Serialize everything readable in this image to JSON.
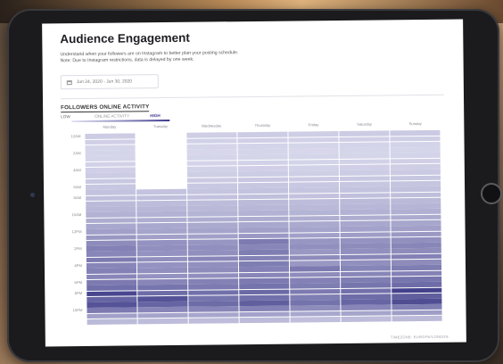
{
  "page": {
    "title": "Audience Engagement",
    "description_line1": "Understand when your followers are on Instagram to better plan your posting schedule.",
    "description_line2": "Note: Due to Instagram restrictions, data is delayed by one week.",
    "date_range": "Jun 24, 2020 - Jun 30, 2020",
    "section_title": "FOLLOWERS ONLINE ACTIVITY",
    "legend": {
      "low": "LOW",
      "mid": "ONLINE ACTIVITY",
      "high": "HIGH"
    },
    "footer": "TIMEZONE: EUROPE/LONDON"
  },
  "heatmap": {
    "days": [
      "Monday",
      "Tuesday",
      "Wednesday",
      "Thursday",
      "Friday",
      "Saturday",
      "Sunday"
    ],
    "hour_labels": [
      "12AM",
      "2AM",
      "4AM",
      "6AM",
      "8AM",
      "10AM",
      "12PM",
      "2PM",
      "4PM",
      "6PM",
      "8PM",
      "10PM"
    ],
    "low_color": "#e6e6f5",
    "high_color": "#3b3886",
    "empty_color": "#ffffff",
    "levels": [
      [
        0.15,
        null,
        0.14,
        0.15,
        0.14,
        0.15,
        0.16
      ],
      [
        0.13,
        null,
        0.12,
        0.13,
        0.12,
        0.13,
        0.14
      ],
      [
        0.1,
        null,
        0.1,
        0.11,
        0.1,
        0.11,
        0.11
      ],
      [
        0.1,
        null,
        0.09,
        0.1,
        0.09,
        0.1,
        0.1
      ],
      [
        0.1,
        null,
        0.1,
        0.1,
        0.1,
        0.1,
        0.11
      ],
      [
        0.12,
        null,
        0.11,
        0.12,
        0.11,
        0.12,
        0.13
      ],
      [
        0.13,
        null,
        0.12,
        0.13,
        0.12,
        0.13,
        0.14
      ],
      [
        0.15,
        null,
        0.14,
        0.15,
        0.14,
        0.15,
        0.16
      ],
      [
        0.17,
        null,
        0.16,
        0.17,
        0.16,
        0.17,
        0.18
      ],
      [
        0.18,
        null,
        0.17,
        0.18,
        0.17,
        0.18,
        0.19
      ],
      [
        0.2,
        0.2,
        0.19,
        0.2,
        0.19,
        0.2,
        0.21
      ],
      [
        0.22,
        0.22,
        0.21,
        0.22,
        0.21,
        0.22,
        0.23
      ],
      [
        0.25,
        0.24,
        0.24,
        0.25,
        0.24,
        0.25,
        0.26
      ],
      [
        0.27,
        0.27,
        0.26,
        0.27,
        0.26,
        0.27,
        0.28
      ],
      [
        0.3,
        0.3,
        0.29,
        0.3,
        0.29,
        0.3,
        0.31
      ],
      [
        0.33,
        0.32,
        0.32,
        0.33,
        0.32,
        0.33,
        0.34
      ],
      [
        0.36,
        0.36,
        0.35,
        0.36,
        0.35,
        0.36,
        0.37
      ],
      [
        0.4,
        0.38,
        0.38,
        0.4,
        0.38,
        0.39,
        0.4
      ],
      [
        0.45,
        0.4,
        0.4,
        0.44,
        0.4,
        0.42,
        0.44
      ],
      [
        0.52,
        0.48,
        0.46,
        0.62,
        0.46,
        0.48,
        0.5
      ],
      [
        0.58,
        0.5,
        0.5,
        0.55,
        0.5,
        0.52,
        0.55
      ],
      [
        0.55,
        0.48,
        0.5,
        0.6,
        0.45,
        0.5,
        0.52
      ],
      [
        0.62,
        0.5,
        0.55,
        0.58,
        0.52,
        0.55,
        0.58
      ],
      [
        0.55,
        0.48,
        0.5,
        0.6,
        0.45,
        0.5,
        0.52
      ],
      [
        0.58,
        0.5,
        0.52,
        0.58,
        0.62,
        0.56,
        0.6
      ],
      [
        0.55,
        0.48,
        0.5,
        0.55,
        0.52,
        0.55,
        0.58
      ],
      [
        0.62,
        0.55,
        0.58,
        0.62,
        0.58,
        0.6,
        0.65
      ],
      [
        0.68,
        0.65,
        0.62,
        0.66,
        0.6,
        0.65,
        0.7
      ],
      [
        0.92,
        0.7,
        0.68,
        0.72,
        0.62,
        0.68,
        0.95
      ],
      [
        0.75,
        0.85,
        0.65,
        0.68,
        0.6,
        0.7,
        0.78
      ],
      [
        0.85,
        0.75,
        0.7,
        0.78,
        0.66,
        0.74,
        0.88
      ],
      [
        0.62,
        0.55,
        0.55,
        0.58,
        0.52,
        0.55,
        0.6
      ],
      [
        0.4,
        0.38,
        0.37,
        0.39,
        0.36,
        0.38,
        0.42
      ],
      [
        0.25,
        0.24,
        0.24,
        0.25,
        0.23,
        0.24,
        0.26
      ]
    ]
  }
}
